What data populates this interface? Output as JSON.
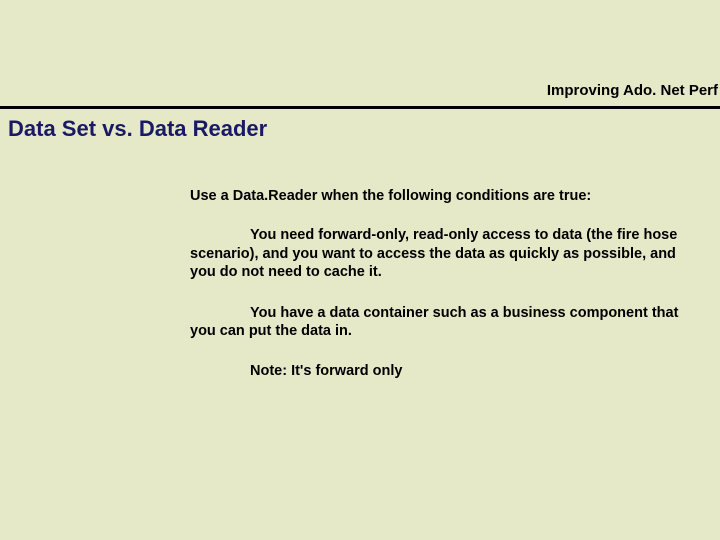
{
  "header": {
    "breadcrumb": "Improving Ado. Net Perf"
  },
  "title": "Data Set vs. Data Reader",
  "content": {
    "lead": "Use a Data.Reader when the following conditions are true:",
    "para1": "You need forward-only, read-only access to data (the fire hose scenario), and you want to access the data as quickly as possible, and you do not need to cache it.",
    "para2": "You have a data container such as a business component that you can put the data in.",
    "note": "Note: It's forward only"
  }
}
